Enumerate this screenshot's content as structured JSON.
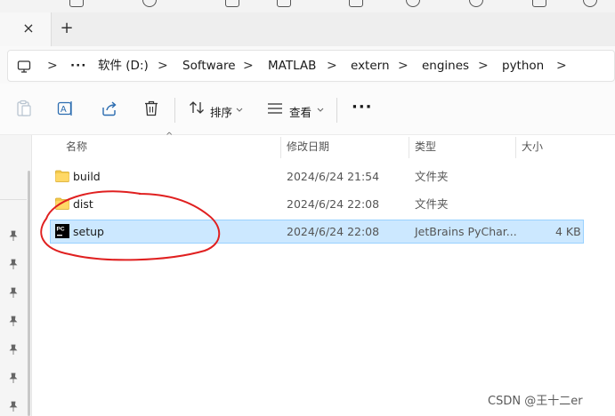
{
  "tabs": {
    "close_symbol": "×",
    "new_symbol": "+"
  },
  "address": {
    "overflow": "···",
    "crumbs": [
      "软件 (D:)",
      "Software",
      "MATLAB",
      "extern",
      "engines",
      "python"
    ],
    "separator": ">"
  },
  "toolbar": {
    "sort_label": "排序",
    "view_label": "查看",
    "more_label": "···"
  },
  "columns": {
    "name": "名称",
    "modified": "修改日期",
    "type": "类型",
    "size": "大小"
  },
  "files": [
    {
      "name": "build",
      "modified": "2024/6/24 21:54",
      "type": "文件夹",
      "size": "",
      "icon": "folder-icon"
    },
    {
      "name": "dist",
      "modified": "2024/6/24 22:08",
      "type": "文件夹",
      "size": "",
      "icon": "folder-icon"
    },
    {
      "name": "setup",
      "modified": "2024/6/24 22:08",
      "type": "JetBrains PyChar...",
      "size": "4 KB",
      "icon": "pycharm-file-icon",
      "selected": true
    }
  ],
  "watermark": "CSDN @王十二er",
  "colors": {
    "selection": "#cce8ff",
    "selection_border": "#99d1ff",
    "annotation": "#e02020",
    "folder": "#f2c94c"
  }
}
